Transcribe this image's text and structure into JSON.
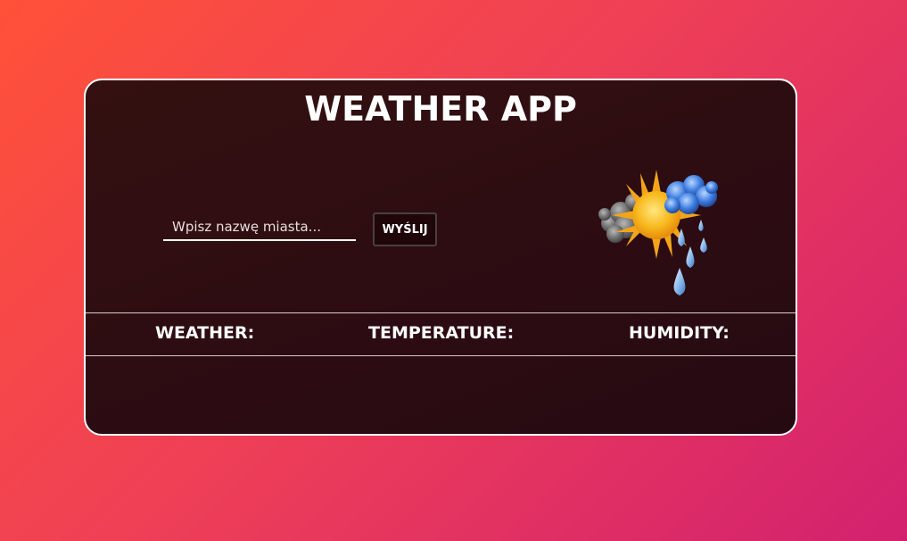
{
  "app": {
    "title": "WEATHER APP"
  },
  "search": {
    "placeholder": "Wpisz nazwę miasta...",
    "value": "",
    "submit_label": "WYŚLIJ"
  },
  "icon": {
    "name": "sun-clouds-rain-icon"
  },
  "info": {
    "weather_label": "WEATHER:",
    "temperature_label": "TEMPERATURE:",
    "humidity_label": "HUMIDITY:"
  },
  "colors": {
    "background_start": "#ff5138",
    "background_end": "#d3216f",
    "card_background": "#2c0c12",
    "text": "#ffffff"
  }
}
